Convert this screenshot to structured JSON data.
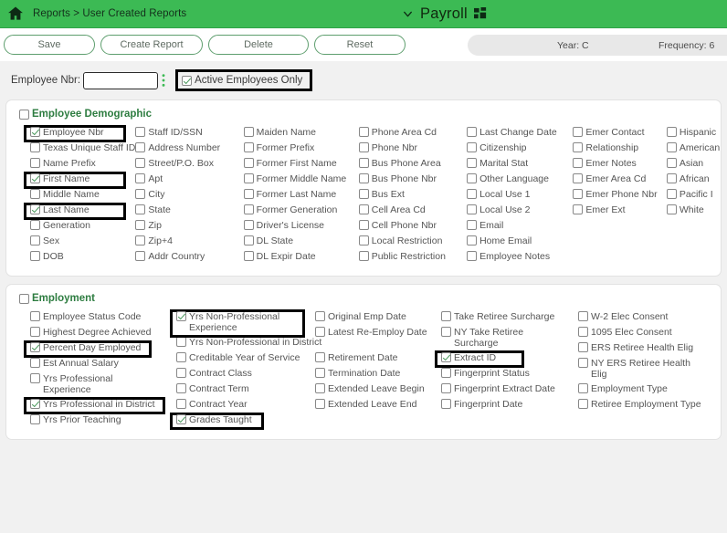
{
  "header": {
    "home_icon": "home-icon",
    "breadcrumb": "Reports > User Created Reports",
    "chevron_icon": "chevron-down-icon",
    "app_title": "Payroll",
    "grid_icon": "grid-icon",
    "accent_green": "#3cba54"
  },
  "toolbar": {
    "buttons": [
      {
        "label": "Save",
        "name": "save-button"
      },
      {
        "label": "Create Report",
        "name": "create-report-button"
      },
      {
        "label": "Delete",
        "name": "delete-button"
      },
      {
        "label": "Reset",
        "name": "reset-button"
      }
    ],
    "status": {
      "year": "Year: C",
      "frequency": "Frequency: 6"
    }
  },
  "filter_row": {
    "employee_nbr_label": "Employee Nbr:",
    "employee_nbr_value": "",
    "employee_nbr_placeholder": "",
    "dots_icon": "vertical-dots-icon",
    "active_only_label": "Active Employees Only",
    "active_only_checked": true,
    "active_only_highlighted": true
  },
  "sections": [
    {
      "title": "Employee Demographic",
      "checked": false,
      "columns": [
        [
          {
            "label": "Employee Nbr",
            "checked": true,
            "highlight": true,
            "width": 112
          },
          {
            "label": "Texas Unique Staff ID",
            "checked": false
          },
          {
            "label": "Name Prefix",
            "checked": false
          },
          {
            "label": "First Name",
            "checked": true,
            "highlight": true,
            "width": 112
          },
          {
            "label": "Middle Name",
            "checked": false
          },
          {
            "label": "Last Name",
            "checked": true,
            "highlight": true,
            "width": 112
          },
          {
            "label": "Generation",
            "checked": false
          },
          {
            "label": "Sex",
            "checked": false
          },
          {
            "label": "DOB",
            "checked": false
          }
        ],
        [
          {
            "label": "Staff ID/SSN",
            "checked": false
          },
          {
            "label": "Address Number",
            "checked": false
          },
          {
            "label": "Street/P.O. Box",
            "checked": false
          },
          {
            "label": "Apt",
            "checked": false
          },
          {
            "label": "City",
            "checked": false
          },
          {
            "label": "State",
            "checked": false
          },
          {
            "label": "Zip",
            "checked": false
          },
          {
            "label": "Zip+4",
            "checked": false
          },
          {
            "label": "Addr Country",
            "checked": false
          }
        ],
        [
          {
            "label": "Maiden Name",
            "checked": false
          },
          {
            "label": "Former Prefix",
            "checked": false
          },
          {
            "label": "Former First Name",
            "checked": false
          },
          {
            "label": "Former Middle Name",
            "checked": false
          },
          {
            "label": "Former Last Name",
            "checked": false
          },
          {
            "label": "Former Generation",
            "checked": false
          },
          {
            "label": "Driver's License",
            "checked": false
          },
          {
            "label": "DL State",
            "checked": false
          },
          {
            "label": "DL Expir Date",
            "checked": false
          }
        ],
        [
          {
            "label": "Phone Area Cd",
            "checked": false
          },
          {
            "label": "Phone Nbr",
            "checked": false
          },
          {
            "label": "Bus Phone Area",
            "checked": false
          },
          {
            "label": "Bus Phone Nbr",
            "checked": false
          },
          {
            "label": "Bus Ext",
            "checked": false
          },
          {
            "label": "Cell Area Cd",
            "checked": false
          },
          {
            "label": "Cell Phone Nbr",
            "checked": false
          },
          {
            "label": "Local Restriction",
            "checked": false
          },
          {
            "label": "Public Restriction",
            "checked": false
          }
        ],
        [
          {
            "label": "Last Change Date",
            "checked": false
          },
          {
            "label": "Citizenship",
            "checked": false
          },
          {
            "label": "Marital Stat",
            "checked": false
          },
          {
            "label": "Other Language",
            "checked": false
          },
          {
            "label": "Local Use 1",
            "checked": false
          },
          {
            "label": "Local Use 2",
            "checked": false
          },
          {
            "label": "Email",
            "checked": false
          },
          {
            "label": "Home Email",
            "checked": false
          },
          {
            "label": "Employee Notes",
            "checked": false
          }
        ],
        [
          {
            "label": "Emer Contact",
            "checked": false
          },
          {
            "label": "Relationship",
            "checked": false
          },
          {
            "label": "Emer Notes",
            "checked": false
          },
          {
            "label": "Emer Area Cd",
            "checked": false
          },
          {
            "label": "Emer Phone Nbr",
            "checked": false
          },
          {
            "label": "Emer Ext",
            "checked": false
          }
        ],
        [
          {
            "label": "Hispanic",
            "checked": false
          },
          {
            "label": "American",
            "checked": false
          },
          {
            "label": "Asian",
            "checked": false
          },
          {
            "label": "African",
            "checked": false
          },
          {
            "label": "Pacific I",
            "checked": false
          },
          {
            "label": "White",
            "checked": false
          }
        ]
      ]
    },
    {
      "title": "Employment",
      "checked": false,
      "columns": [
        [
          {
            "label": "Employee Status Code",
            "checked": false
          },
          {
            "label": "Highest Degree Achieved",
            "checked": false
          },
          {
            "label": "Percent Day Employed",
            "checked": true,
            "highlight": true,
            "width": 140
          },
          {
            "label": "Est Annual Salary",
            "checked": false
          },
          {
            "label": "Yrs Professional Experience",
            "checked": false,
            "wrap": true
          },
          {
            "label": "Yrs Professional in District",
            "checked": true,
            "highlight": true,
            "width": 155
          },
          {
            "label": "Yrs Prior Teaching",
            "checked": false
          }
        ],
        [
          {
            "label": "Yrs Non-Professional Experience",
            "checked": true,
            "highlight": true,
            "wrap": true,
            "width": 148
          },
          {
            "label": "Yrs Non-Professional in District",
            "checked": false
          },
          {
            "label": "Creditable Year of Service",
            "checked": false
          },
          {
            "label": "Contract Class",
            "checked": false
          },
          {
            "label": "Contract Term",
            "checked": false
          },
          {
            "label": "Contract Year",
            "checked": false
          },
          {
            "label": "Grades Taught",
            "checked": true,
            "highlight": true,
            "width": 103
          }
        ],
        [
          {
            "label": "Original Emp Date",
            "checked": false
          },
          {
            "label": "Latest Re-Employ Date",
            "checked": false,
            "wrap": true
          },
          {
            "label": "Retirement Date",
            "checked": false
          },
          {
            "label": "Termination Date",
            "checked": false
          },
          {
            "label": "Extended Leave Begin",
            "checked": false
          },
          {
            "label": "Extended Leave End",
            "checked": false
          }
        ],
        [
          {
            "label": "Take Retiree Surcharge",
            "checked": false
          },
          {
            "label": "NY Take Retiree Surcharge",
            "checked": false,
            "wrap": true
          },
          {
            "label": "Extract ID",
            "checked": true,
            "highlight": true,
            "width": 98
          },
          {
            "label": "Fingerprint Status",
            "checked": false
          },
          {
            "label": "Fingerprint Extract Date",
            "checked": false
          },
          {
            "label": "Fingerprint Date",
            "checked": false
          }
        ],
        [
          {
            "label": "W-2 Elec Consent",
            "checked": false
          },
          {
            "label": "1095 Elec Consent",
            "checked": false
          },
          {
            "label": "ERS Retiree Health Elig",
            "checked": false
          },
          {
            "label": "NY ERS Retiree Health Elig",
            "checked": false,
            "wrap": true
          },
          {
            "label": "Employment Type",
            "checked": false
          },
          {
            "label": "Retiree Employment Type",
            "checked": false
          }
        ]
      ]
    }
  ]
}
